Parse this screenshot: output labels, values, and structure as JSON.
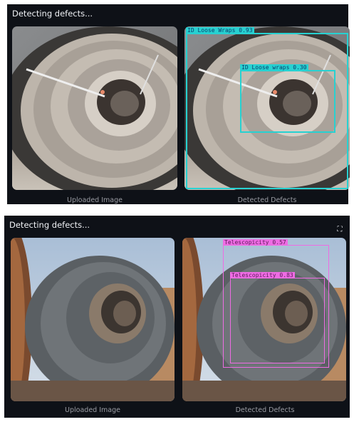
{
  "panels": [
    {
      "title": "Detecting defects...",
      "uploaded_caption": "Uploaded Image",
      "detected_caption": "Detected Defects",
      "detections": [
        {
          "label": "ID Loose Wraps 0.93",
          "color": "#27d1d1"
        },
        {
          "label": "ID Loose wraps 0.30",
          "color": "#27d1d1"
        }
      ]
    },
    {
      "title": "Detecting defects...",
      "uploaded_caption": "Uploaded Image",
      "detected_caption": "Detected Defects",
      "fullscreen_icon": "fullscreen-icon",
      "detections": [
        {
          "label": "Telescopicity 0.57",
          "color": "#ee6ce3"
        },
        {
          "label": "Telescopicity 0.83",
          "color": "#ee6ce3"
        }
      ]
    }
  ]
}
